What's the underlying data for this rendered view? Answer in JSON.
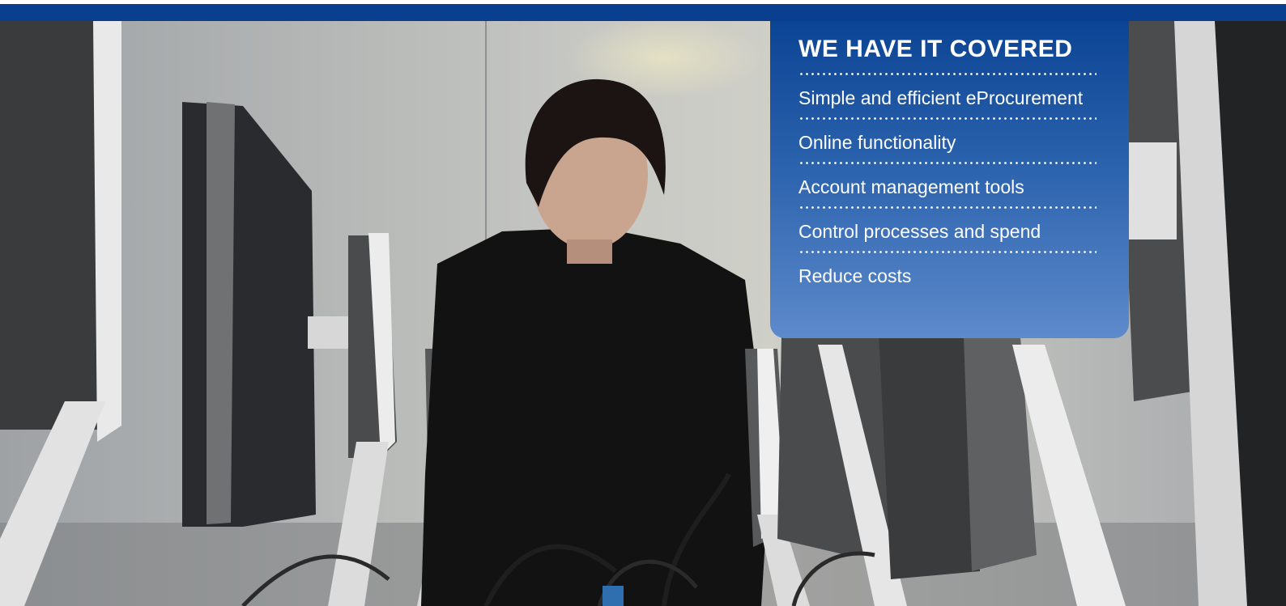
{
  "panel": {
    "title": "WE HAVE IT COVERED",
    "items": [
      {
        "label": "Simple and efficient eProcurement"
      },
      {
        "label": "Online functionality"
      },
      {
        "label": "Account management tools"
      },
      {
        "label": "Control processes and spend"
      },
      {
        "label": "Reduce costs"
      }
    ]
  },
  "colors": {
    "top_bar": "#0a3f90",
    "panel_top": "#0b4494",
    "panel_bottom": "#5d8acb",
    "text": "#ffffff"
  }
}
